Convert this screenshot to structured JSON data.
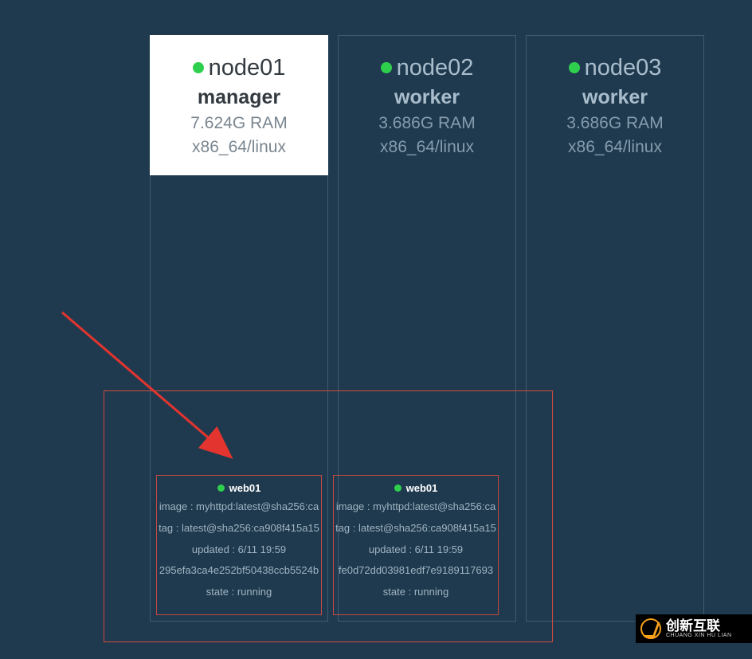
{
  "nodes": [
    {
      "name": "node01",
      "role": "manager",
      "ram": "7.624G RAM",
      "arch": "x86_64/linux",
      "selected": true
    },
    {
      "name": "node02",
      "role": "worker",
      "ram": "3.686G RAM",
      "arch": "x86_64/linux",
      "selected": false
    },
    {
      "name": "node03",
      "role": "worker",
      "ram": "3.686G RAM",
      "arch": "x86_64/linux",
      "selected": false
    }
  ],
  "services": [
    {
      "title": "web01",
      "image": "image : myhttpd:latest@sha256:ca",
      "tag": "tag : latest@sha256:ca908f415a15",
      "updated": "updated : 6/11 19:59",
      "hash": "295efa3ca4e252bf50438ccb5524b",
      "state": "state : running"
    },
    {
      "title": "web01",
      "image": "image : myhttpd:latest@sha256:ca",
      "tag": "tag : latest@sha256:ca908f415a15",
      "updated": "updated : 6/11 19:59",
      "hash": "fe0d72dd03981edf7e9189117693",
      "state": "state : running"
    }
  ],
  "brand": {
    "main": "创新互联",
    "sub": "CHUANG XIN HU LIAN"
  }
}
